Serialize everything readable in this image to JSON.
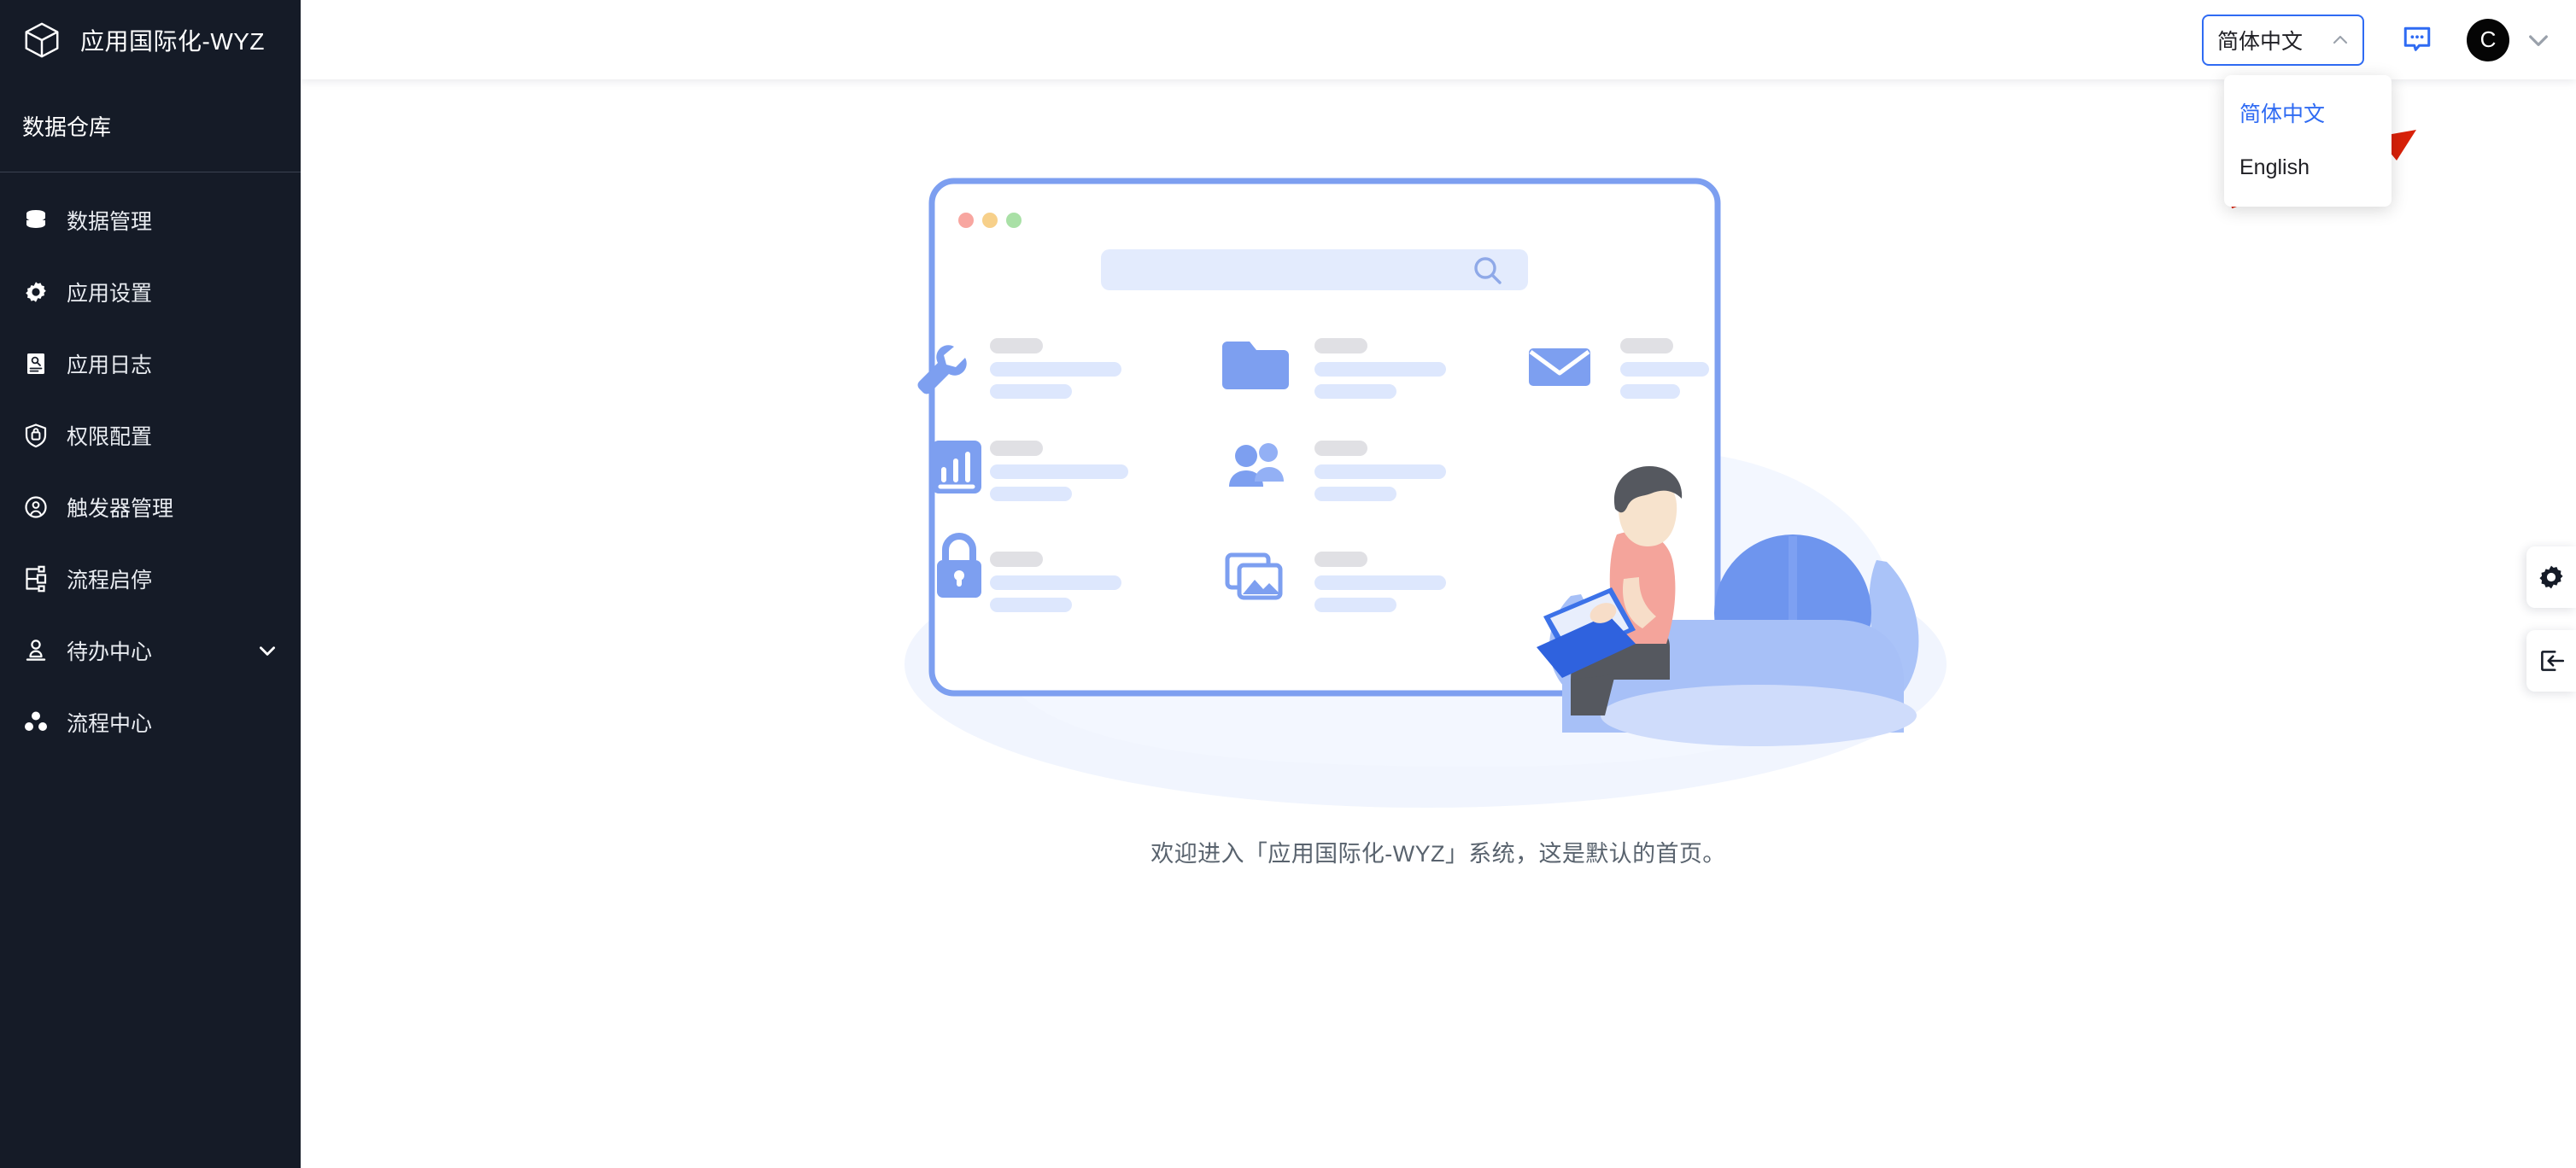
{
  "sidebar": {
    "brand": {
      "title": "应用国际化-WYZ",
      "icon": "cube-icon"
    },
    "group_label": "数据仓库",
    "items": [
      {
        "label": "数据管理",
        "icon": "database-icon",
        "expandable": false
      },
      {
        "label": "应用设置",
        "icon": "gear-icon",
        "expandable": false
      },
      {
        "label": "应用日志",
        "icon": "log-document-icon",
        "expandable": false
      },
      {
        "label": "权限配置",
        "icon": "shield-lock-icon",
        "expandable": false
      },
      {
        "label": "触发器管理",
        "icon": "trigger-target-icon",
        "expandable": false
      },
      {
        "label": "流程启停",
        "icon": "flow-branch-icon",
        "expandable": false
      },
      {
        "label": "待办中心",
        "icon": "user-stamp-icon",
        "expandable": true
      },
      {
        "label": "流程中心",
        "icon": "nodes-cluster-icon",
        "expandable": false
      }
    ]
  },
  "topbar": {
    "language_selector": {
      "value": "简体中文",
      "caret_icon": "chevron-up-icon",
      "open": true,
      "options": [
        {
          "label": "简体中文",
          "selected": true
        },
        {
          "label": "English",
          "selected": false
        }
      ]
    },
    "message_icon": "comment-dots-icon",
    "avatar": {
      "initial": "C",
      "icon": "avatar"
    },
    "user_caret_icon": "chevron-down-icon"
  },
  "content": {
    "welcome_text": "欢迎进入「应用国际化-WYZ」系统，这是默认的首页。",
    "illustration": {
      "name": "empty-state-illustration",
      "window_dots": [
        "#f8a6a0",
        "#f7d08a",
        "#a9e0a6"
      ],
      "search_placeholder": "",
      "search_icon": "search-icon",
      "tile_icons": [
        "wrench-icon",
        "folder-icon",
        "envelope-icon",
        "bar-chart-icon",
        "users-icon",
        "lock-icon",
        "images-icon"
      ]
    }
  },
  "annotation": {
    "arrow": {
      "color": "#d82109",
      "name": "red-pointer-arrow"
    }
  },
  "float_rail": [
    {
      "icon": "gear-icon",
      "name": "settings-float-button"
    },
    {
      "icon": "login-enter-icon",
      "name": "enter-float-button"
    }
  ],
  "colors": {
    "sidebar_bg": "#151b27",
    "accent": "#2f6bf3",
    "illustration_blue": "#7d9ff0",
    "arrow_red": "#d82109",
    "text_muted": "#59636e"
  }
}
